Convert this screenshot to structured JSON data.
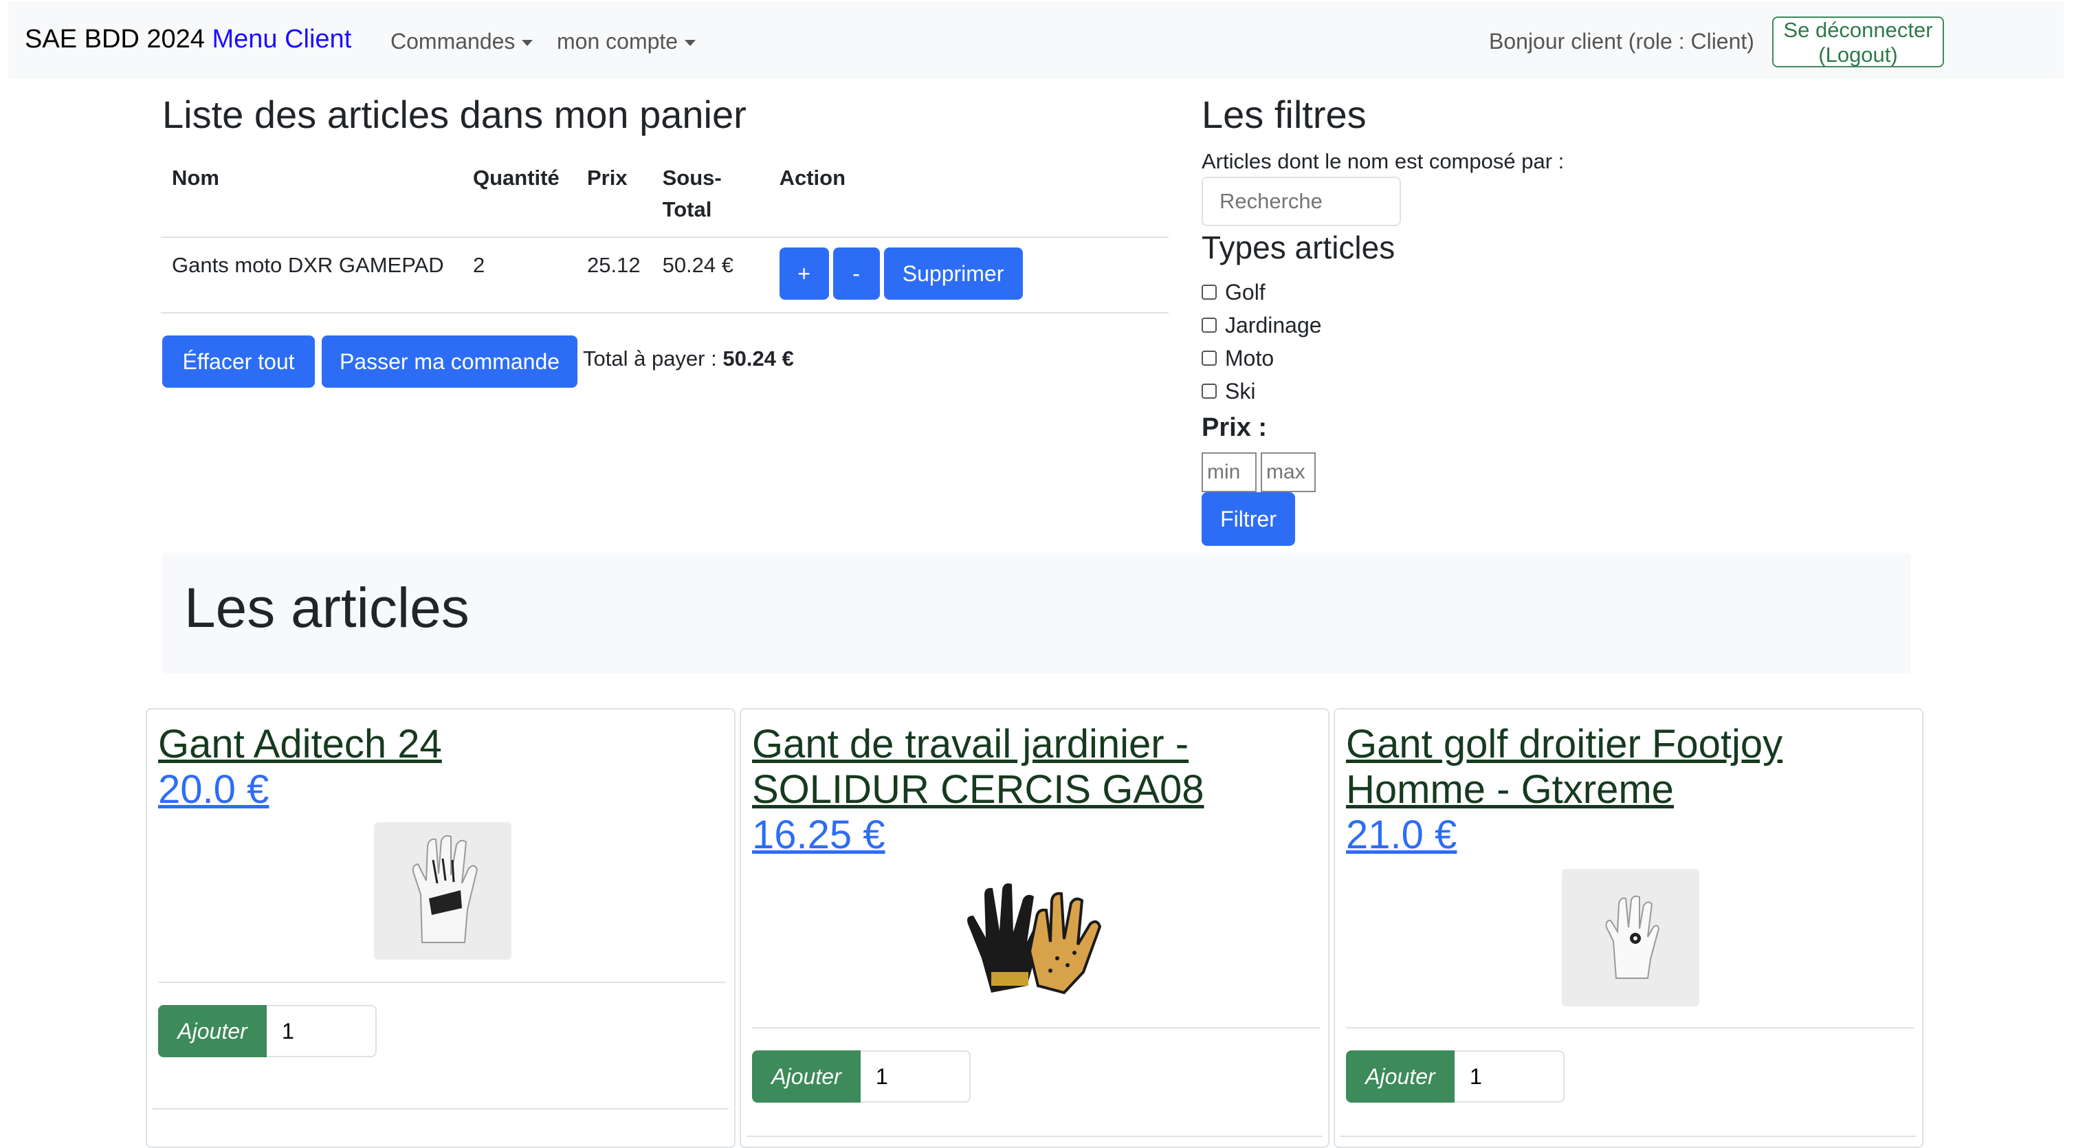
{
  "navbar": {
    "brand": "SAE BDD 2024",
    "brand_accent": "Menu Client",
    "commandes_label": "Commandes",
    "compte_label": "mon compte",
    "greeting": "Bonjour client (role : Client)",
    "logout_label": "Se déconnecter (Logout)"
  },
  "cart": {
    "title": "Liste des articles dans mon panier",
    "headers": {
      "nom": "Nom",
      "quantite": "Quantité",
      "prix": "Prix",
      "sous_total": "Sous-Total",
      "action": "Action"
    },
    "rows": [
      {
        "nom": "Gants moto DXR GAMEPAD",
        "quantite": "2",
        "prix": "25.12",
        "sous_total": "50.24 €"
      }
    ],
    "plus_label": "+",
    "minus_label": "-",
    "delete_label": "Supprimer",
    "clear_label": "Éffacer tout",
    "order_label": "Passer ma commande",
    "total_label": "Total à payer :",
    "total_value": "50.24 €"
  },
  "filters": {
    "title": "Les filtres",
    "name_label": "Articles dont le nom est composé par :",
    "search_placeholder": "Recherche",
    "types_title": "Types articles",
    "types": [
      "Golf",
      "Jardinage",
      "Moto",
      "Ski"
    ],
    "price_title": "Prix :",
    "min_placeholder": "min",
    "max_placeholder": "max",
    "filter_button": "Filtrer"
  },
  "articles": {
    "title": "Les articles",
    "add_label": "Ajouter",
    "items": [
      {
        "name": "Gant Aditech 24",
        "price": "20.0 €",
        "qty": "1",
        "image": "golf-glove-icon"
      },
      {
        "name": "Gant de travail jardinier - SOLIDUR CERCIS GA08",
        "price": "16.25 €",
        "qty": "1",
        "image": "work-glove-icon"
      },
      {
        "name": "Gant golf droitier Footjoy Homme - Gtxreme",
        "price": "21.0 €",
        "qty": "1",
        "image": "golf-glove-icon"
      }
    ]
  },
  "colors": {
    "primary": "#2d6df6",
    "success": "#3d8a5a",
    "brand_accent": "#1a0dff"
  }
}
